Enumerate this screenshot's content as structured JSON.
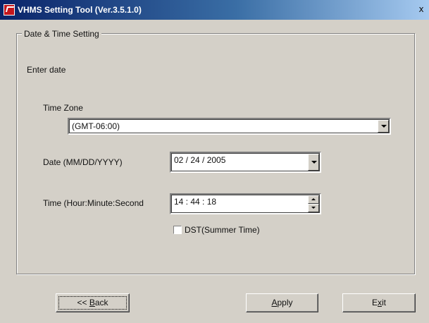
{
  "window": {
    "title": "VHMS Setting Tool (Ver.3.5.1.0)",
    "close_glyph": "x",
    "icon_name": "vhms-app-icon",
    "title_gradient": [
      "#0a246a",
      "#a6caf0"
    ],
    "face_color": "#d4d0c8"
  },
  "group": {
    "legend": "Date & Time Setting"
  },
  "form": {
    "instruction": "Enter date",
    "time_zone": {
      "label": "Time Zone",
      "value": "(GMT-06:00)"
    },
    "date": {
      "label": "Date (MM/DD/YYYY)",
      "value": "02 / 24 / 2005"
    },
    "time": {
      "label": "Time (Hour:Minute:Second",
      "value": "14 : 44 : 18"
    },
    "dst": {
      "label": "DST(Summer Time)",
      "checked": false
    }
  },
  "buttons": {
    "back": {
      "prefix": "<< ",
      "mnemonic": "B",
      "rest": "ack"
    },
    "apply": {
      "mnemonic": "A",
      "rest": "pply"
    },
    "exit": {
      "first": "E",
      "mnemonic": "x",
      "rest": "it"
    }
  }
}
